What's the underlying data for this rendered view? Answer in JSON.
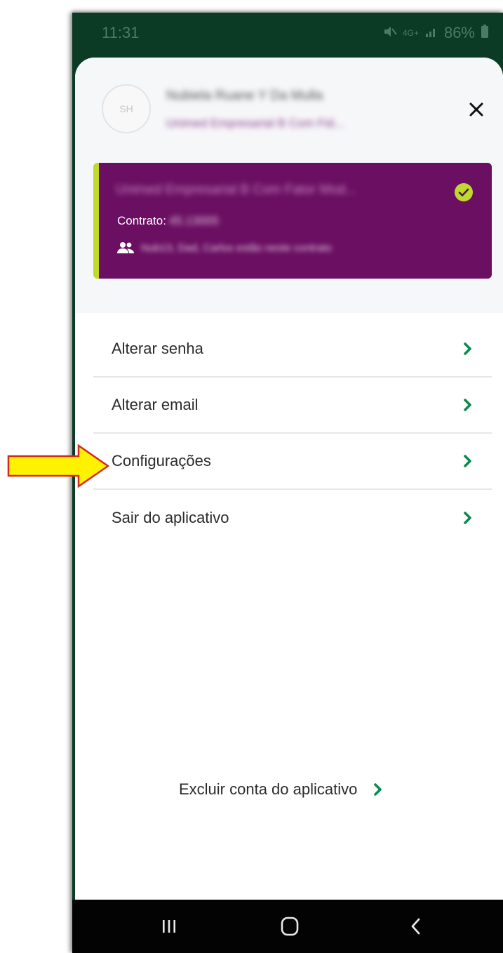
{
  "status_bar": {
    "time": "11:31",
    "network": "4G+",
    "battery": "86%",
    "icons": [
      "mute-icon",
      "signal-icon",
      "battery-icon"
    ]
  },
  "profile": {
    "avatar_initials": "SH",
    "name": "Nubiela Ruane Y Da Mulla",
    "plan": "Unimed Empresarial B Com Fid..."
  },
  "contract_card": {
    "title": "Unimed Empresarial B Com Fator Mod...",
    "contract_label": "Contrato:",
    "contract_number": "45.13005",
    "beneficiaries": "Nub13, Dad, Carlos estão neste contrato",
    "check_icon": "check-circle-icon"
  },
  "menu": {
    "items": [
      {
        "label": "Alterar senha"
      },
      {
        "label": "Alterar email"
      },
      {
        "label": "Configurações"
      },
      {
        "label": "Sair do aplicativo"
      }
    ]
  },
  "footer": {
    "delete_account_label": "Excluir conta do aplicativo"
  },
  "colors": {
    "status_bar_bg": "#0b3b24",
    "card_bg": "#6b0f63",
    "card_accent": "#c1d82f",
    "chevron": "#0d8a4f",
    "annotation_arrow_fill": "#fff200",
    "annotation_arrow_stroke": "#d42a1c"
  },
  "nav_bar": {
    "buttons": [
      "recent-apps-icon",
      "home-icon",
      "back-icon"
    ]
  }
}
